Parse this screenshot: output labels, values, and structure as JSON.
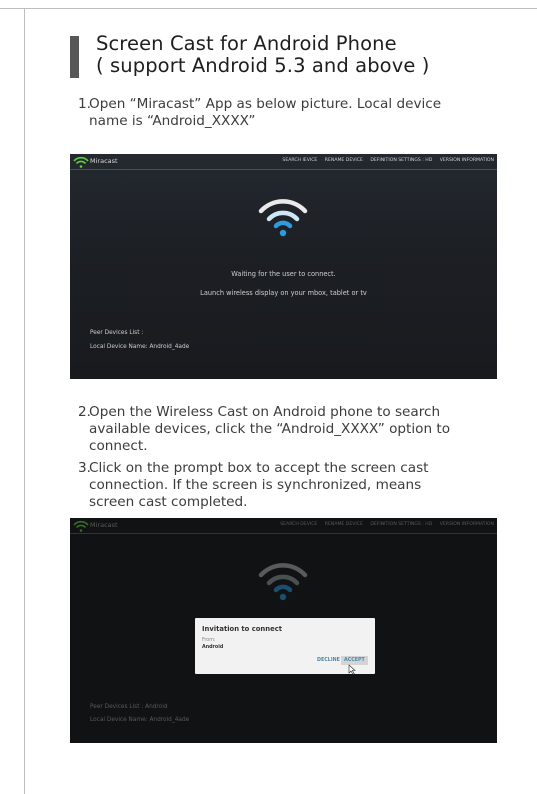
{
  "title": {
    "line1": "Screen Cast for Android Phone",
    "line2": "( support Android 5.3 and above )"
  },
  "steps": [
    {
      "num": "1.",
      "lines": [
        "Open “Miracast” App as below picture. Local device",
        "name is “Android_XXXX”"
      ]
    },
    {
      "num": "2.",
      "lines": [
        "Open the Wireless Cast on Android phone to search",
        "available devices, click the “Android_XXXX” option to",
        "connect."
      ]
    },
    {
      "num": "3.",
      "lines": [
        "Click on the prompt box to accept the screen cast",
        "connection. If the screen is synchronized, means",
        "screen cast completed."
      ]
    }
  ],
  "screenshot1": {
    "app_name": "Miracast",
    "menu": [
      "SEARCH IEVICE",
      "RENAME DEVICE",
      "DEFINITION SETTINGS : HD",
      "VERSION INFORMATION"
    ],
    "waiting": "Waiting for the user to connect.",
    "launch": "Launch wireless display on your mbox, tablet or tv",
    "peer_list_label": "Peer Devices List :",
    "local_device_label": "Local Device Name:",
    "local_device_value": "Android_4ade"
  },
  "screenshot2": {
    "app_name": "Miracast",
    "menu": [
      "SEARCH DEVICE",
      "RENAME DEVICE",
      "DEFINITION SETTINGS : HD",
      "VERSION INFORMATION"
    ],
    "dialog": {
      "title": "Invitation to connect",
      "from_label": "From:",
      "from_value": "Android",
      "decline": "DECLINE",
      "accept": "ACCEPT"
    },
    "peer_list_label": "Peer Devices List :",
    "peer_list_value": "Android",
    "local_device_label": "Local Device Name:",
    "local_device_value": "Android_4ade"
  },
  "icons": [
    "wifi-icon",
    "miracast-logo-icon",
    "cursor-icon"
  ],
  "colors": {
    "accent": "#2e9be0",
    "bar": "#575757"
  }
}
